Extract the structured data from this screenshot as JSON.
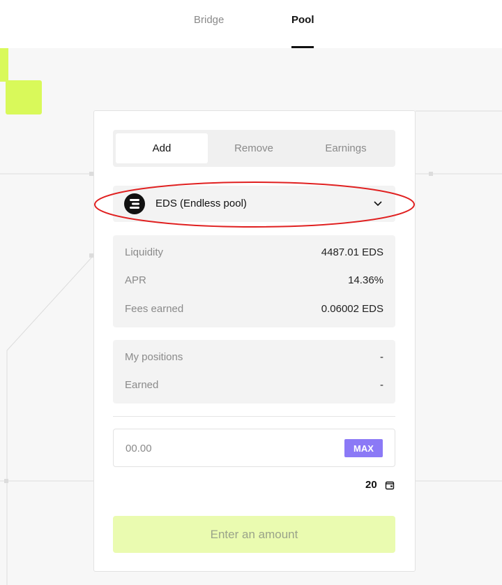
{
  "nav": {
    "tabs": [
      {
        "label": "Bridge"
      },
      {
        "label": "Pool"
      }
    ]
  },
  "segment": {
    "options": [
      {
        "label": "Add"
      },
      {
        "label": "Remove"
      },
      {
        "label": "Earnings"
      }
    ]
  },
  "pool_select": {
    "label": "EDS (Endless pool)",
    "icon": "endless-logo-icon"
  },
  "stats": [
    {
      "label": "Liquidity",
      "value": "4487.01 EDS"
    },
    {
      "label": "APR",
      "value": "14.36%"
    },
    {
      "label": "Fees earned",
      "value": "0.06002 EDS"
    }
  ],
  "mine": [
    {
      "label": "My positions",
      "value": "-"
    },
    {
      "label": "Earned",
      "value": "-"
    }
  ],
  "amount": {
    "placeholder": "00.00",
    "max_label": "MAX"
  },
  "balance": {
    "value": "20",
    "icon": "wallet-icon"
  },
  "submit": {
    "label": "Enter an amount"
  },
  "colors": {
    "accent": "#d9f95a",
    "max": "#8b79f6",
    "submit_bg": "#eafbb0",
    "highlight": "#e02020"
  }
}
